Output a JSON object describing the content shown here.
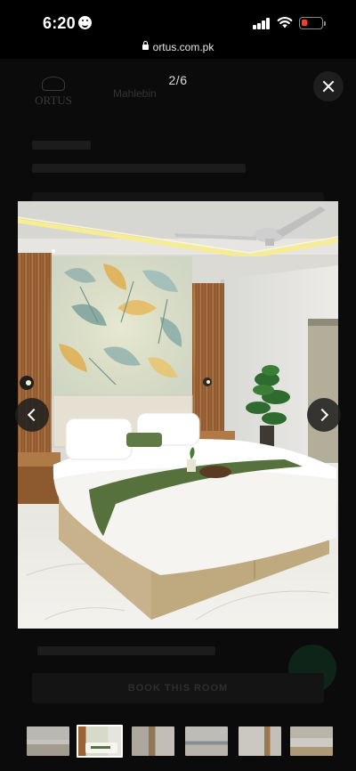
{
  "status_bar": {
    "time": "6:20"
  },
  "browser": {
    "url": "ortus.com.pk"
  },
  "viewer": {
    "counter": "2/6",
    "close_icon": "close-icon",
    "prev_icon": "chevron-left-icon",
    "next_icon": "chevron-right-icon",
    "current_index": 2,
    "total": 6,
    "thumbnails": [
      {
        "scene": "lounge"
      },
      {
        "scene": "bedroom"
      },
      {
        "scene": "hallway"
      },
      {
        "scene": "living"
      },
      {
        "scene": "dining"
      },
      {
        "scene": "room"
      }
    ]
  },
  "background_page": {
    "logo_text": "ORTUS",
    "nav_text": "Mahlebin",
    "book_button": "BOOK THIS ROOM"
  },
  "colors": {
    "overlay": "#000000",
    "button_bg": "#1e1e1e",
    "headboard_panel": "#e4dccb",
    "wood_slats": "#a36a3c",
    "bed_base": "#c9b590",
    "green_runner": "#4f6b3a",
    "led_strip": "#f3e79a"
  }
}
